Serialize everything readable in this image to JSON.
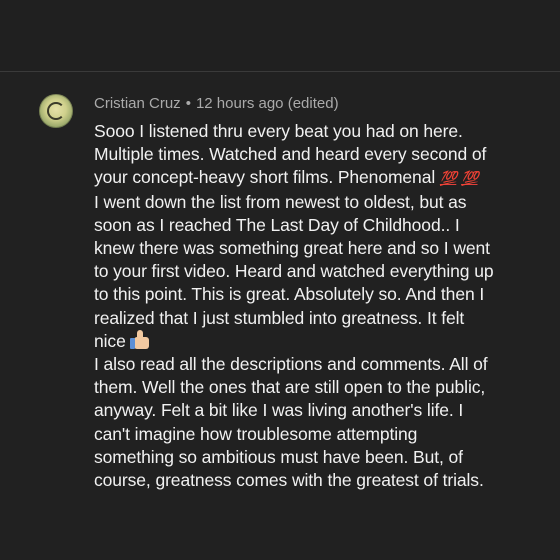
{
  "comment": {
    "author": "Cristian Cruz",
    "separator": "•",
    "time": "12 hours ago",
    "edited": "(edited)",
    "lines": [
      "Sooo I listened thru every beat you had on here.",
      "Multiple times. Watched and heard every second of",
      "your concept-heavy short films. Phenomenal",
      " I went down the list from newest to oldest, but as",
      "soon as I reached The Last Day of Childhood.. I",
      "knew there was something great here and so I went",
      "to your first video. Heard and watched everything up",
      "to this point. This is great. Absolutely so. And then I",
      "realized that I just stumbled into greatness. It felt",
      "nice",
      "I also read all the descriptions and comments. All of",
      "them. Well the ones that are still open to the public,",
      "anyway. Felt a bit like I was living another's life. I",
      "can't imagine how troublesome attempting",
      "something so ambitious must have been. But, of",
      "course, greatness comes with the greatest of trials."
    ],
    "emoji_hundred": "💯",
    "emoji_hundred_2": "💯",
    "icons": {
      "hundred": "hundred-points-emoji",
      "thumb": "thumbs-up-emoji"
    }
  },
  "colors": {
    "background": "#212121",
    "meta_text": "#aaaaaa",
    "body_text": "#f1f1f1",
    "emoji_red": "#e0403a"
  }
}
